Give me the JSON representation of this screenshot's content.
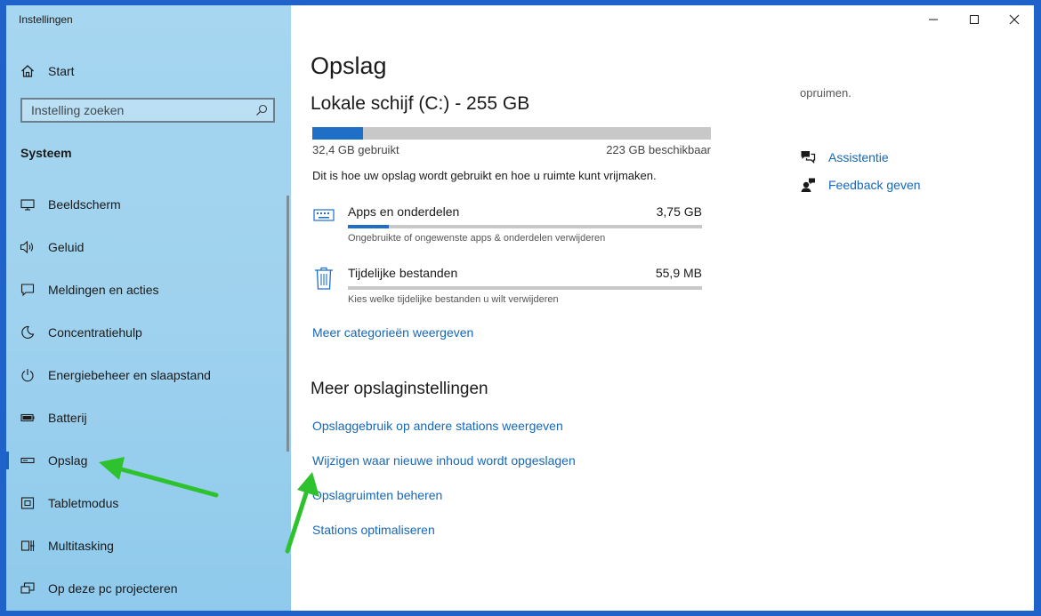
{
  "app": {
    "title": "Instellingen"
  },
  "sidebar": {
    "home_label": "Start",
    "search_placeholder": "Instelling zoeken",
    "section": "Systeem",
    "items": [
      {
        "label": "Beeldscherm",
        "icon": "monitor-icon"
      },
      {
        "label": "Geluid",
        "icon": "speaker-icon"
      },
      {
        "label": "Meldingen en acties",
        "icon": "notification-icon"
      },
      {
        "label": "Concentratiehulp",
        "icon": "moon-icon"
      },
      {
        "label": "Energiebeheer en slaapstand",
        "icon": "power-icon"
      },
      {
        "label": "Batterij",
        "icon": "battery-icon"
      },
      {
        "label": "Opslag",
        "icon": "storage-icon",
        "active": true
      },
      {
        "label": "Tabletmodus",
        "icon": "tablet-icon"
      },
      {
        "label": "Multitasking",
        "icon": "multitasking-icon"
      },
      {
        "label": "Op deze pc projecteren",
        "icon": "project-icon"
      }
    ]
  },
  "main": {
    "title": "Opslag",
    "drive": "Lokale schijf (C:) - 255 GB",
    "usage": {
      "used_label": "32,4 GB gebruikt",
      "free_label": "223 GB beschikbaar",
      "used_fraction": 0.127
    },
    "description": "Dit is hoe uw opslag wordt gebruikt en hoe u ruimte kunt vrijmaken.",
    "categories": [
      {
        "name": "Apps en onderdelen",
        "size": "3,75 GB",
        "sub": "Ongebruikte of ongewenste apps & onderdelen verwijderen",
        "icon": "keyboard-icon",
        "fraction": 0.116
      },
      {
        "name": "Tijdelijke bestanden",
        "size": "55,9 MB",
        "sub": "Kies welke tijdelijke bestanden u wilt verwijderen",
        "icon": "trash-icon",
        "fraction": 0.0
      }
    ],
    "more_categories_link": "Meer categorieën weergeven",
    "more_settings_title": "Meer opslaginstellingen",
    "links": [
      "Opslaggebruik op andere stations weergeven",
      "Wijzigen waar nieuwe inhoud wordt opgeslagen",
      "Opslagruimten beheren",
      "Stations optimaliseren"
    ]
  },
  "right": {
    "note": "opruimen.",
    "help": [
      {
        "label": "Assistentie",
        "icon": "chat-help-icon"
      },
      {
        "label": "Feedback geven",
        "icon": "feedback-icon"
      }
    ]
  },
  "colors": {
    "accent": "#1f6fc6",
    "link": "#1667b8",
    "annotation_arrow": "#2fc22f",
    "desktop": "#1f62c9"
  }
}
